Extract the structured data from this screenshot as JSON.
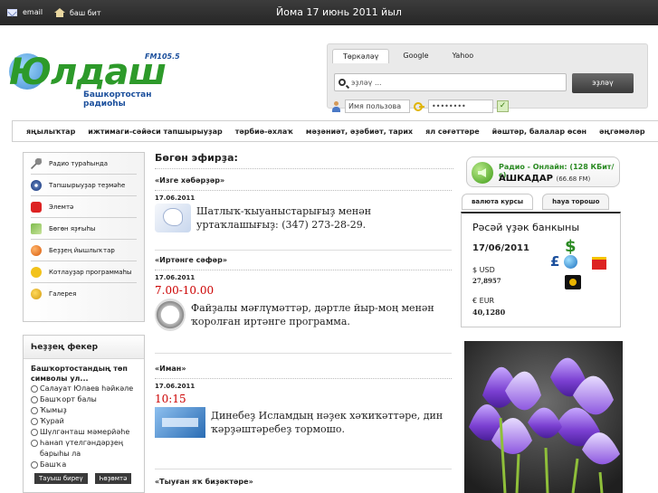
{
  "topbar": {
    "email_label": "email",
    "home_label": "баш бит",
    "date": "Йома 17 июнь 2011 йыл"
  },
  "logo": {
    "name": "Юлдаш",
    "frequency": "FM105.5",
    "subtitle": "Башкортостан радиоhы"
  },
  "search": {
    "tabs": [
      "Төркәләү",
      "Google",
      "Yahoo"
    ],
    "placeholder": "эҙләү ...",
    "button": "эҙләү"
  },
  "login": {
    "username_placeholder": "Имя пользова",
    "password_value": "••••••••",
    "submit": "✓"
  },
  "nav": {
    "items": [
      "яңылыҡтар",
      "ижтимаги-сәйәси тапшырыуҙар",
      "тәрбиә-әхлаҡ",
      "мәҙәниәт, әҙәбиәт, тарих",
      "ял сәғәттәре",
      "йәштәр, балалар өсөн",
      "әңгәмәләр"
    ]
  },
  "sidebar": {
    "items": [
      {
        "label": "Радио тураһында",
        "icon": "microphone-icon"
      },
      {
        "label": "Тапшырыуҙар теҙмәһе",
        "icon": "disc-icon"
      },
      {
        "label": "Элемтә",
        "icon": "phone-icon"
      },
      {
        "label": "Бөгөн яҙғыһы",
        "icon": "money-icon"
      },
      {
        "label": "Беҙҙең йышлыҡтар",
        "icon": "ball-icon"
      },
      {
        "label": "Котлауҙар программаһы",
        "icon": "smile-icon"
      },
      {
        "label": "Галерея",
        "icon": "gallery-icon"
      }
    ]
  },
  "poll": {
    "title": "Һеҙҙең фекер",
    "question": "Башҡортостандың төп символы ул...",
    "options": [
      "Салауат Юлаев һәйкәле",
      "Башҡорт балы",
      "Ҡымыҙ",
      "Ҡурай",
      "Шүлгәнташ мәмерйәһе",
      "Һанап үтелгәндәрҙең барыһы ла",
      "Башҡа"
    ],
    "vote_button": "Тауыш биреү",
    "results_button": "Һөҙөмтә"
  },
  "content": {
    "heading": "Бөгөн эфирҙа:",
    "programs": [
      {
        "title": "«Изге хәбәрҙәр»",
        "date": "17.06.2011",
        "time": "",
        "text": "Шатлыҡ-ҡыуаныстарығыҙ менән уртаҡлашығыҙ: (347) 273-28-29."
      },
      {
        "title": "«Иртәнге сәфәр»",
        "date": "17.06.2011",
        "time": "7.00-10.00",
        "text": "Файҙалы мәғлүмәттәр, дәртле йыр-моң менән ҡоролған иртәнге программа."
      },
      {
        "title": "«Иман»",
        "date": "17.06.2011",
        "time": "10:15",
        "text": "Динебеҙ Исламдың нәҙек хәҡиҡәттәре, дин ҡәрҙәштәребеҙ тормошо."
      },
      {
        "title": "«Тыуған яҡ биҙәктәре»"
      }
    ]
  },
  "radio_online": {
    "label": "Радио - Онлайн: (128 КБит/с)",
    "station": "АШКАДАР",
    "freq": "(66.68 FM)"
  },
  "currency": {
    "tabs": [
      "валюта курсы",
      "һауа торошо"
    ],
    "bank": "Рәсәй үҙәк банкыны",
    "date": "17/06/2011",
    "usd_label": "$ USD",
    "usd_value": "27,8957",
    "eur_label": "€ EUR",
    "eur_value": "40,1280"
  },
  "colors": {
    "accent_green": "#2d9a2a",
    "brand_blue": "#1b4f9c",
    "time_red": "#c00000",
    "topbar": "#2f2f2f"
  }
}
